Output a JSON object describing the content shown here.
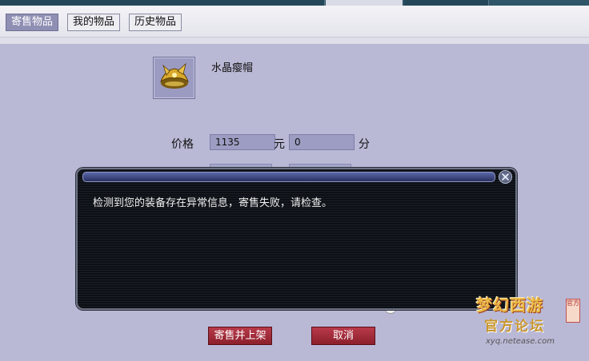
{
  "tabs": [
    {
      "label": "寄售物品",
      "active": true
    },
    {
      "label": "我的物品",
      "active": false
    },
    {
      "label": "历史物品",
      "active": false
    }
  ],
  "item": {
    "name": "水晶瘿帽",
    "icon": "golden-hat-icon"
  },
  "price": {
    "label": "价格",
    "yuan_value": "1135",
    "yuan_unit": "元",
    "fen_value": "0",
    "fen_unit": "分"
  },
  "buttons": {
    "submit_label": "寄售并上架",
    "cancel_label": "取消"
  },
  "dialog": {
    "message": "检测到您的装备存在异常信息，寄售失败，请检查。",
    "close_icon": "close-icon"
  },
  "watermark": {
    "logo": "梦幻西游",
    "badge": "官方",
    "subtitle": "官方论坛",
    "url": "xyq.netease.com"
  },
  "colors": {
    "button_red": "#a22c3a",
    "active_tab": "#8f8fb4",
    "panel_bg": "#b9b9d6",
    "dialog_bg": "#12161c"
  }
}
